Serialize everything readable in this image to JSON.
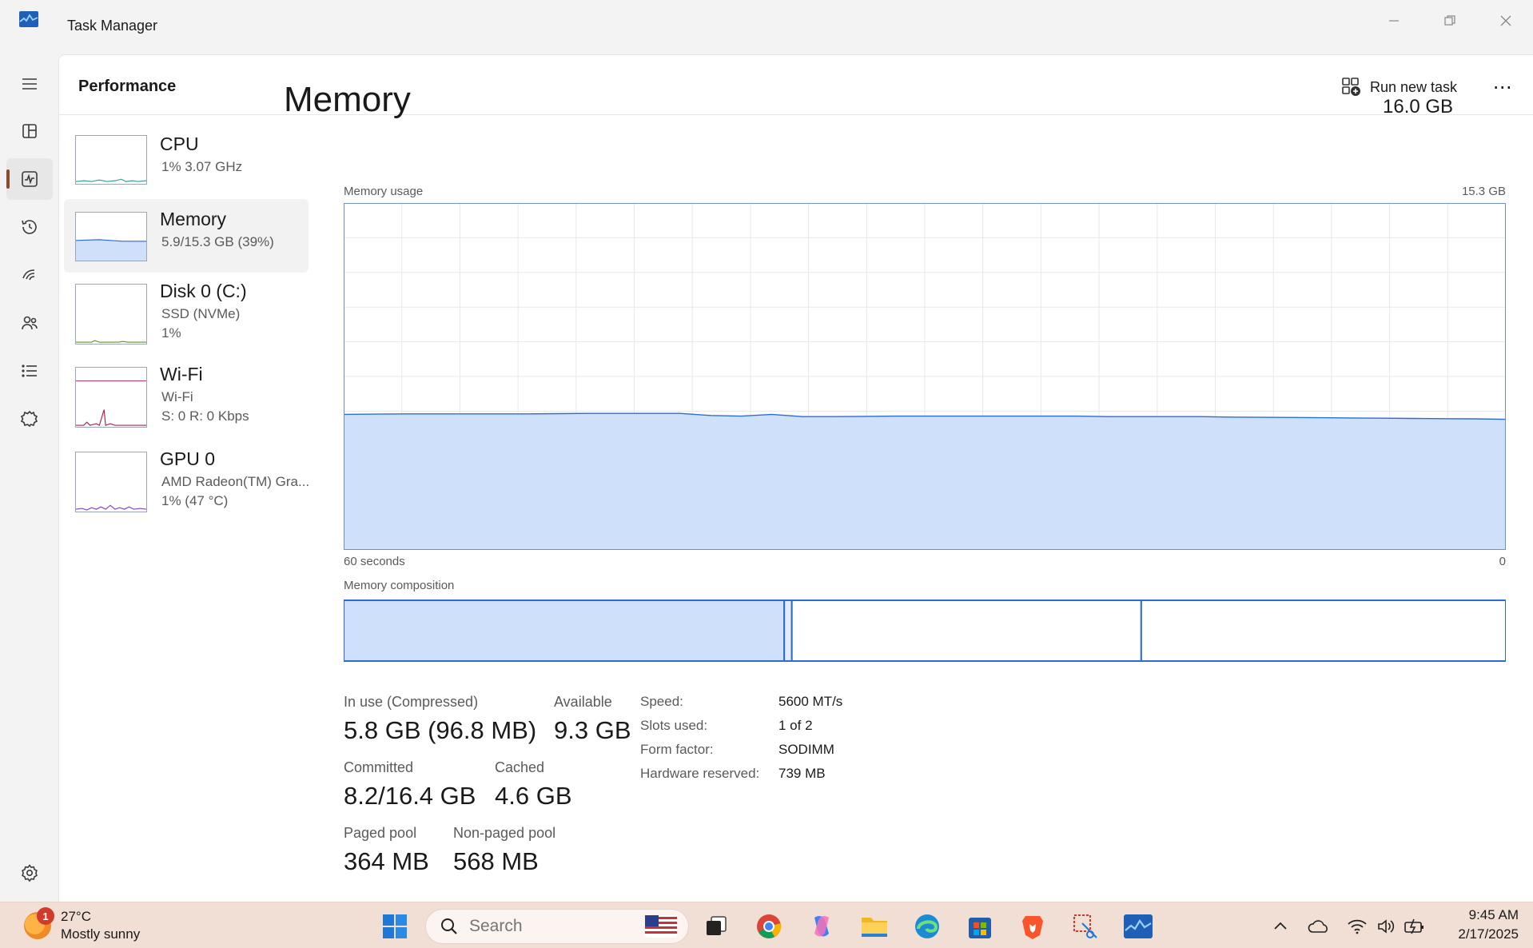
{
  "window": {
    "title": "Task Manager"
  },
  "header": {
    "title": "Performance",
    "run_task_label": "Run new task"
  },
  "devices": [
    {
      "name": "CPU",
      "line1": "1% 3.07 GHz",
      "line2": ""
    },
    {
      "name": "Memory",
      "line1": "5.9/15.3 GB (39%)",
      "line2": ""
    },
    {
      "name": "Disk 0 (C:)",
      "line1": "SSD (NVMe)",
      "line2": "1%"
    },
    {
      "name": "Wi-Fi",
      "line1": "Wi-Fi",
      "line2": "S: 0 R: 0 Kbps"
    },
    {
      "name": "GPU 0",
      "line1": "AMD Radeon(TM) Gra...",
      "line2": "1% (47 °C)"
    }
  ],
  "memory": {
    "title": "Memory",
    "total": "16.0 GB",
    "usage_label": "Memory usage",
    "usage_max": "15.3 GB",
    "time_left": "60 seconds",
    "time_right": "0",
    "composition_label": "Memory composition",
    "usage_history_gb": [
      5.98,
      5.99,
      6.0,
      6.0,
      6.0,
      6.0,
      6.0,
      6.01,
      6.02,
      6.02,
      6.02,
      6.02,
      5.93,
      5.9,
      5.98,
      5.88,
      5.88,
      5.89,
      5.9,
      5.9,
      5.9,
      5.9,
      5.9,
      5.9,
      5.9,
      5.88,
      5.88,
      5.88,
      5.88,
      5.86,
      5.85,
      5.84,
      5.83,
      5.82,
      5.81,
      5.8,
      5.79,
      5.78,
      5.76
    ],
    "composition": {
      "in_use_gb": 5.8,
      "modified_gb": 0.1,
      "standby_gb": 4.6,
      "free_gb": 4.8
    },
    "stats": {
      "in_use_label": "In use (Compressed)",
      "in_use_value": "5.8 GB (96.8 MB)",
      "available_label": "Available",
      "available_value": "9.3 GB",
      "committed_label": "Committed",
      "committed_value": "8.2/16.4 GB",
      "cached_label": "Cached",
      "cached_value": "4.6 GB",
      "paged_label": "Paged pool",
      "paged_value": "364 MB",
      "nonpaged_label": "Non-paged pool",
      "nonpaged_value": "568 MB"
    },
    "specs": {
      "speed_label": "Speed:",
      "speed_value": "5600 MT/s",
      "slots_label": "Slots used:",
      "slots_value": "1 of 2",
      "form_label": "Form factor:",
      "form_value": "SODIMM",
      "hwres_label": "Hardware reserved:",
      "hwres_value": "739 MB"
    }
  },
  "taskbar": {
    "weather_temp": "27°C",
    "weather_desc": "Mostly sunny",
    "weather_badge": "1",
    "search_placeholder": "Search",
    "time": "9:45 AM",
    "date": "2/17/2025"
  },
  "colors": {
    "memory_fill": "#cfe0fb",
    "memory_line": "#2f6bd4",
    "accent": "#8a4b2a",
    "cpu_line": "#3f9a9a",
    "wifi_line": "#b5214e",
    "gpu_line": "#8a3fc9",
    "disk_line": "#6b8f2b"
  }
}
